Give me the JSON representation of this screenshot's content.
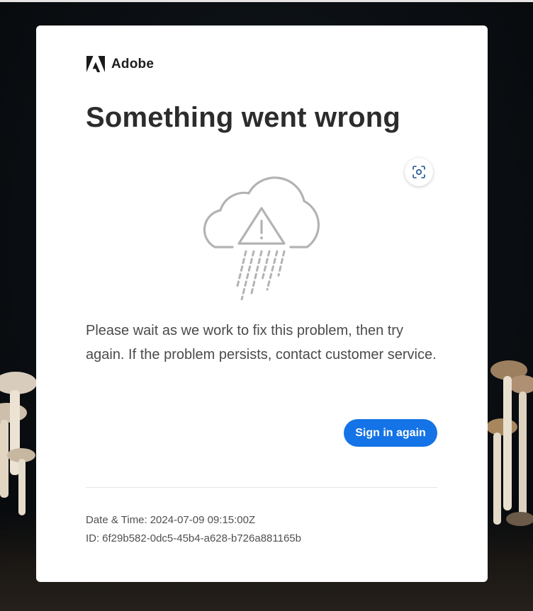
{
  "brand": {
    "name": "Adobe",
    "logo_icon": "adobe-logo-icon"
  },
  "error": {
    "title": "Something went wrong",
    "illustration_icon": "cloud-warning-rain-icon",
    "message": "Please wait as we work to fix this problem, then try again. If the problem persists, contact customer service."
  },
  "actions": {
    "signin_label": "Sign in again",
    "visual_search_icon": "visual-search-icon"
  },
  "meta": {
    "datetime_label": "Date & Time:",
    "datetime_value": "2024-07-09 09:15:00Z",
    "id_label": "ID:",
    "id_value": "6f29b582-0dc5-45b4-a628-b726a881165b"
  },
  "colors": {
    "accent": "#1473e6",
    "title": "#2c2c2c",
    "body_text": "#4b4b4b",
    "background": "#0c0e10"
  }
}
